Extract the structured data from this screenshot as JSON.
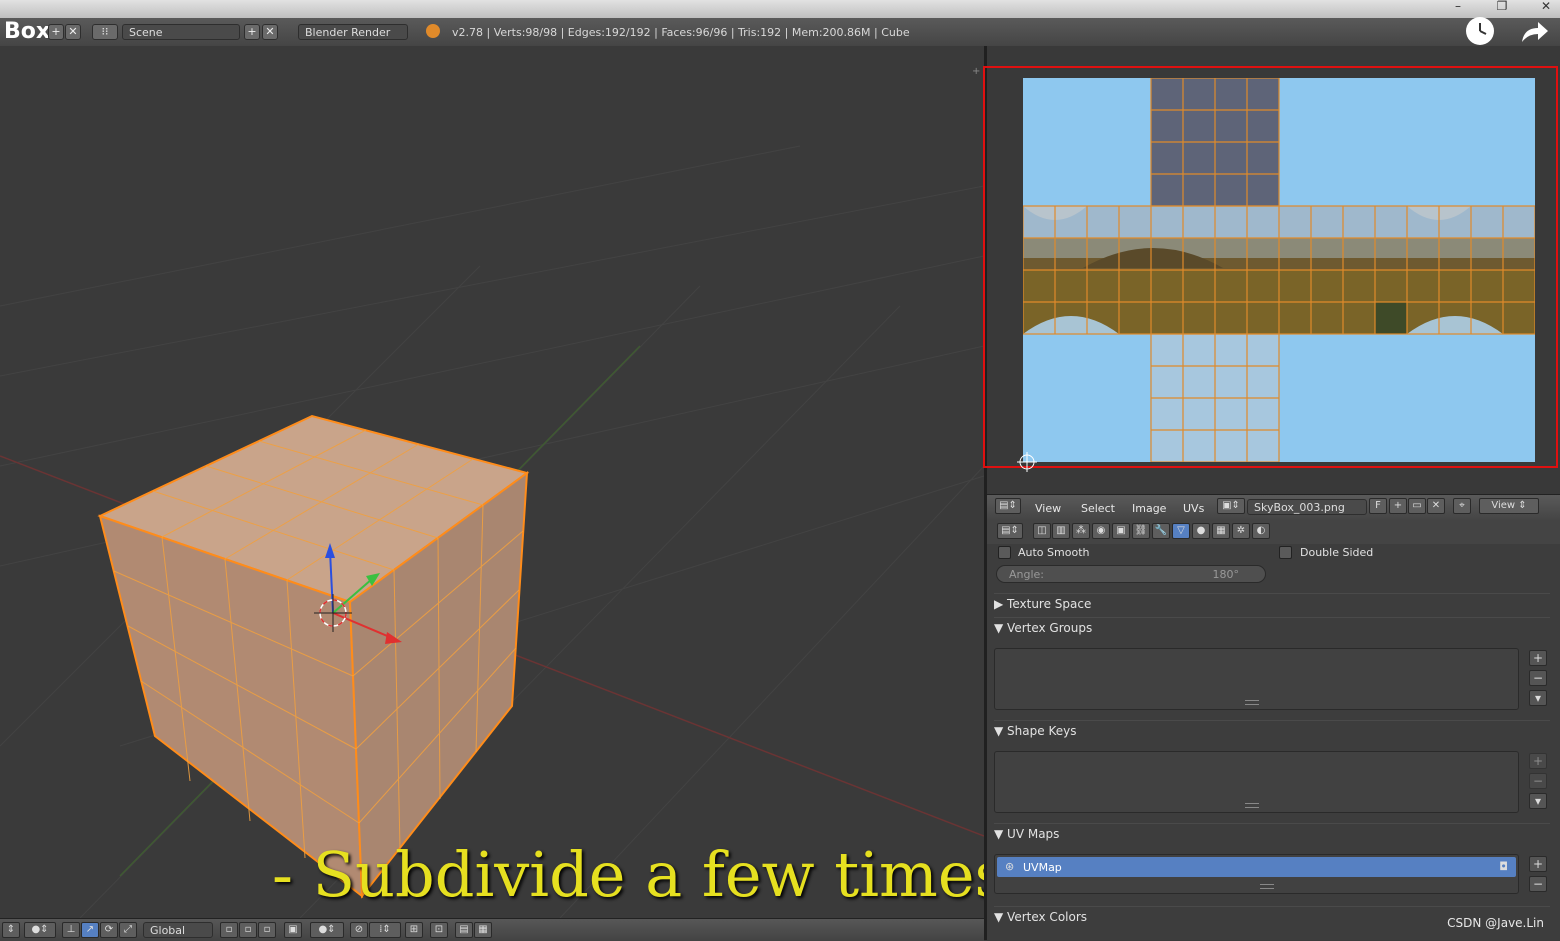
{
  "info_header": {
    "editor_title": "Box",
    "scene_name": "Scene",
    "render_engine": "Blender Render",
    "stats": "v2.78 | Verts:98/98 | Edges:192/192 | Faces:96/96 | Tris:192 | Mem:200.86M | Cube"
  },
  "viewport": {
    "subtitle": "- Subdivide a few times.",
    "orientation": "Global"
  },
  "uv_editor": {
    "menus": [
      "View",
      "Select",
      "Image",
      "UVs"
    ],
    "image_name": "SkyBox_003.png",
    "fake_user": "F",
    "view_menu": "View"
  },
  "properties": {
    "auto_smooth_label": "Auto Smooth",
    "double_sided_label": "Double Sided",
    "angle_label": "Angle:",
    "angle_value": "180°",
    "panels": {
      "texture_space": "Texture Space",
      "vertex_groups": "Vertex Groups",
      "shape_keys": "Shape Keys",
      "uv_maps": "UV Maps",
      "vertex_colors": "Vertex Colors"
    },
    "uv_map_item": "UVMap"
  },
  "watermark": "CSDN @Jave.Lin",
  "colors": {
    "selection_orange": "#ff8c1a",
    "uv_highlight_border": "#e01010",
    "list_selected": "#5680c2",
    "sky_blue": "#8ec8ef",
    "subtitle_yellow": "#e6e020"
  }
}
